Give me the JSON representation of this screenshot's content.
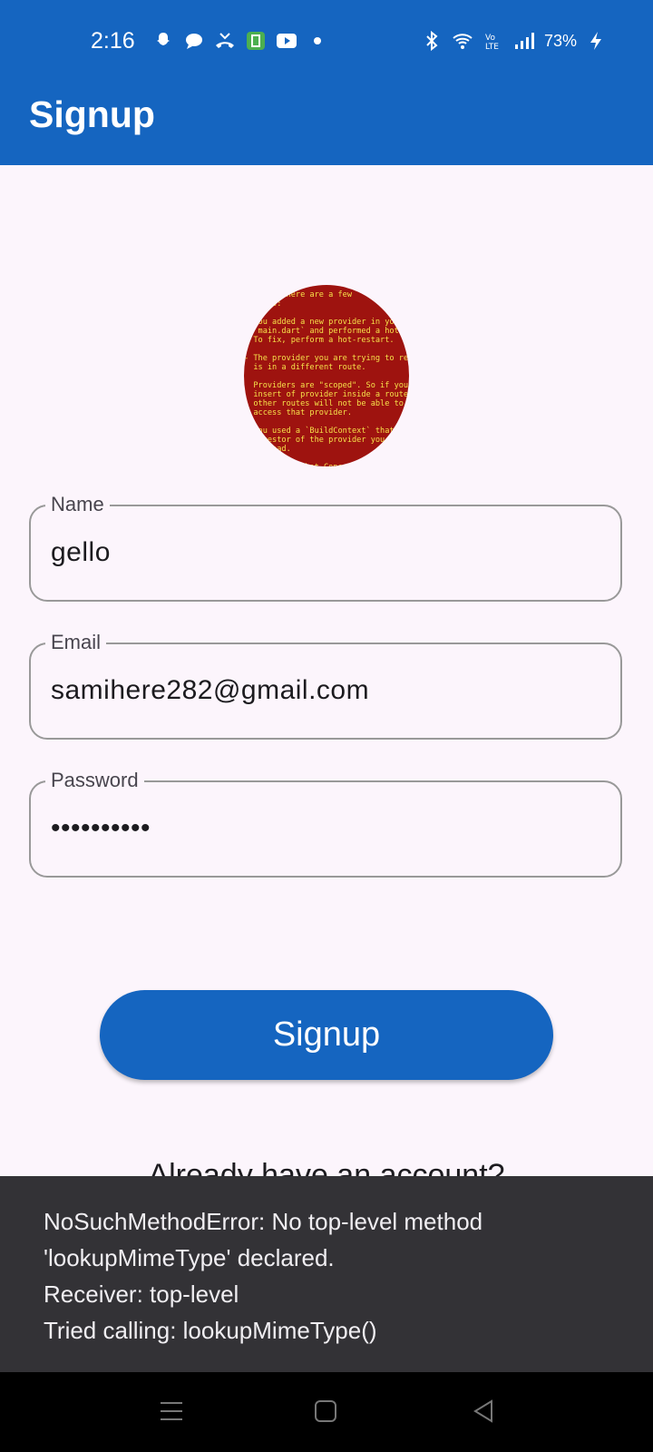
{
  "status_bar": {
    "time": "2:16",
    "battery": "73%",
    "left_icons": [
      "snapchat-icon",
      "chat-icon",
      "missed-call-icon",
      "app-icon",
      "youtube-icon",
      "dot-icon"
    ],
    "right_icons": [
      "bluetooth-icon",
      "wifi-icon",
      "volte-icon",
      "signal-icon",
      "battery-icon"
    ]
  },
  "app_bar": {
    "title": "Signup"
  },
  "avatar": {
    "error_text": "device. There are a few\nreasons:\n\n- You added a new provider in your\n  `main.dart` and performed a hot-reload.\n  To fix, perform a hot-restart.\n\n- The provider you are trying to read\n  is in a different route.\n\n  Providers are \"scoped\". So if you\n  insert of provider inside a route, then\n  other routes will not be able to\n  access that provider.\n\n- You used a `BuildContext` that is an\n  ancestor of the provider you are trying\n  to read.\n\n  Make sure that Consumer<AuthProvider>\n  is under your MultiProvider/\n  ChangeNotifierProvider>."
  },
  "form": {
    "name": {
      "label": "Name",
      "value": "gello"
    },
    "email": {
      "label": "Email",
      "value": "samihere282@gmail.com"
    },
    "password": {
      "label": "Password",
      "value": "••••••••••"
    }
  },
  "signup_button": {
    "label": "Signup"
  },
  "login_link": {
    "label": "Already have an account?"
  },
  "snackbar": {
    "lines": [
      "NoSuchMethodError: No top-level method",
      "'lookupMimeType' declared.",
      "Receiver: top-level",
      "Tried calling: lookupMimeType()"
    ]
  },
  "nav_bar": {
    "buttons": [
      "menu-icon",
      "home-icon",
      "back-icon"
    ]
  },
  "colors": {
    "primary": "#1565c0",
    "background": "#fcf5fc",
    "snackbar": "#333236"
  }
}
